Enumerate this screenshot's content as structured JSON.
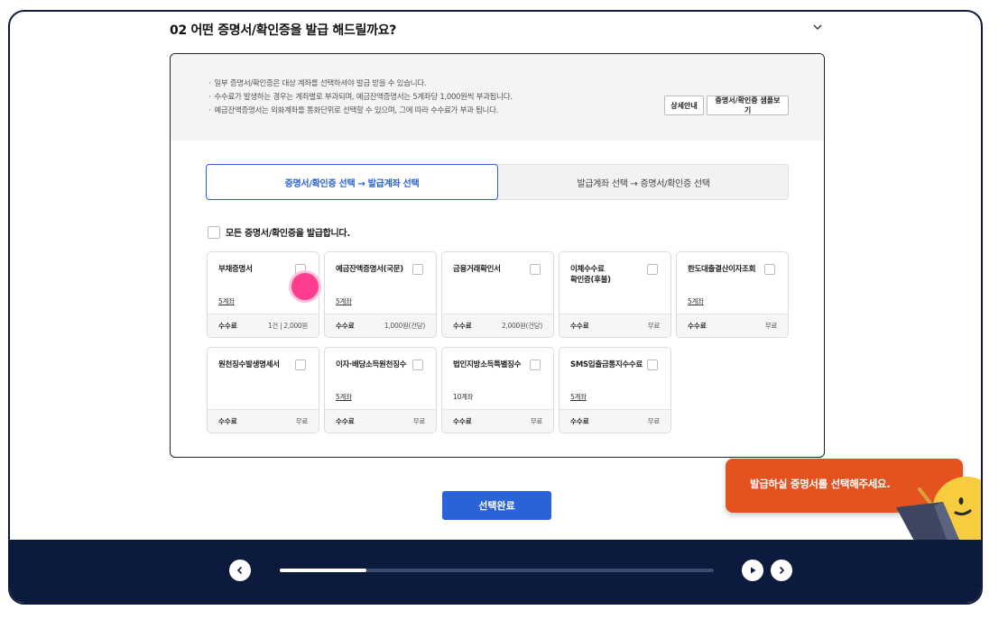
{
  "section": {
    "title": "02 어떤 증명서/확인증을 발급 해드릴까요?"
  },
  "notice": {
    "lines": [
      "일부 증명서/확인증은 대상 계좌를 선택하셔야 발급 받을 수 있습니다.",
      "수수료가 발생하는 경우는 계좌별로 부과되며, 예금잔액증명서는 5계좌당 1,000원씩 부과됩니다.",
      "예금잔액증명서는 외화계좌를 통화단위로 선택할 수 있으며, 그에 따라 수수료가 부과 됩니다."
    ],
    "detail_button": "상세안내",
    "sample_button": "증명서/확인증 샘플보기"
  },
  "tabs": {
    "active": "증명서/확인증 선택 → 발급계좌 선택",
    "inactive": "발급계좌 선택 → 증명서/확인증 선택"
  },
  "select_all": "모든 증명서/확인증을 발급합니다.",
  "fee_label": "수수료",
  "cards": [
    {
      "name": "부채증명서",
      "accounts": "5계좌",
      "fee": "1건 | 2,000원"
    },
    {
      "name": "예금잔액증명서(국문)",
      "accounts": "5계좌",
      "fee": "1,000원(건당)"
    },
    {
      "name": "금융거래확인서",
      "accounts": "",
      "fee": "2,000원(건당)"
    },
    {
      "name": "이체수수료\n확인증(후불)",
      "accounts": "",
      "fee": "무료"
    },
    {
      "name": "한도대출결산이자조회",
      "accounts": "5계좌",
      "fee": "무료"
    },
    {
      "name": "원천징수발생명세서",
      "accounts": "",
      "fee": "무료"
    },
    {
      "name": "이자·배당소득원천징수",
      "accounts": "5계좌",
      "fee": "무료"
    },
    {
      "name": "법인지방소득특별징수",
      "accounts": "10계좌",
      "fee": "무료"
    },
    {
      "name": "SMS입출금통지수수료",
      "accounts": "5계좌",
      "fee": "무료"
    }
  ],
  "complete_button": "선택완료",
  "toast": "발급하실 증명서를 선택해주세요.",
  "player": {
    "progress": 0.2
  },
  "colors": {
    "accent": "#2a63d8",
    "toast": "#e3521f",
    "navy": "#0b1a3d",
    "cursor": "#ff3d8e"
  }
}
